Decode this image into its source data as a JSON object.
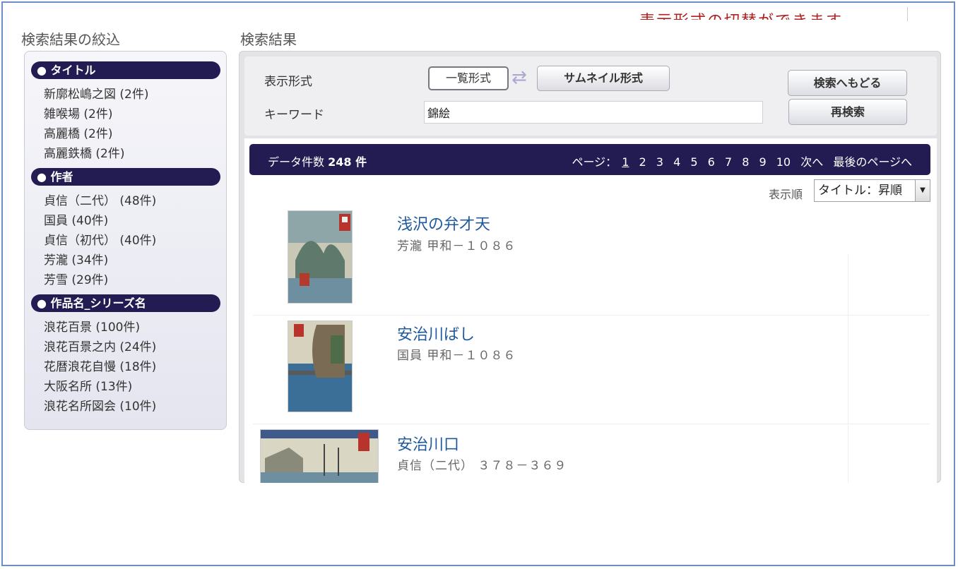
{
  "top_banner": {
    "text": "表示形式の切替ができます"
  },
  "sidebar": {
    "heading": "検索結果の絞込",
    "facets": [
      {
        "title": "● タイトル",
        "items": [
          "新廓松嶋之図 (2件)",
          "雑喉場 (2件)",
          "高麗橋 (2件)",
          "高麗鉄橋 (2件)"
        ]
      },
      {
        "title": "● 作者",
        "items": [
          "貞信（二代） (48件)",
          "国員 (40件)",
          "貞信（初代） (40件)",
          "芳瀧 (34件)",
          "芳雪 (29件)"
        ]
      },
      {
        "title": "● 作品名_シリーズ名",
        "items": [
          "浪花百景 (100件)",
          "浪花百景之内 (24件)",
          "花暦浪花自慢 (18件)",
          "大阪名所 (13件)",
          "浪花名所図会 (10件)"
        ]
      }
    ]
  },
  "main": {
    "heading": "検索結果",
    "display_label": "表示形式",
    "list_button": "一覧形式",
    "thumb_button": "サムネイル形式",
    "keyword_label": "キーワード",
    "keyword_value": "錦絵",
    "back_button": "検索へもどる",
    "research_button": "再検索"
  },
  "results_bar": {
    "count_label": "データ件数",
    "count_value": "248 件",
    "page_label": "ページ：",
    "pages": [
      "1",
      "2",
      "3",
      "4",
      "5",
      "6",
      "7",
      "8",
      "9",
      "10"
    ],
    "next": "次へ",
    "last": "最後のページへ"
  },
  "sort": {
    "label": "表示順",
    "value": "タイトル：昇順"
  },
  "results": [
    {
      "title": "浅沢の弁才天",
      "meta": "芳瀧 甲和－１０８６"
    },
    {
      "title": "安治川ばし",
      "meta": "国員 甲和－１０８６"
    },
    {
      "title": "安治川口",
      "meta": "貞信（二代） ３７８－３６９"
    }
  ],
  "colors": {
    "accent_navy": "#231c52",
    "link_blue": "#1f5a9e",
    "frame_blue": "#6f8fc4"
  }
}
